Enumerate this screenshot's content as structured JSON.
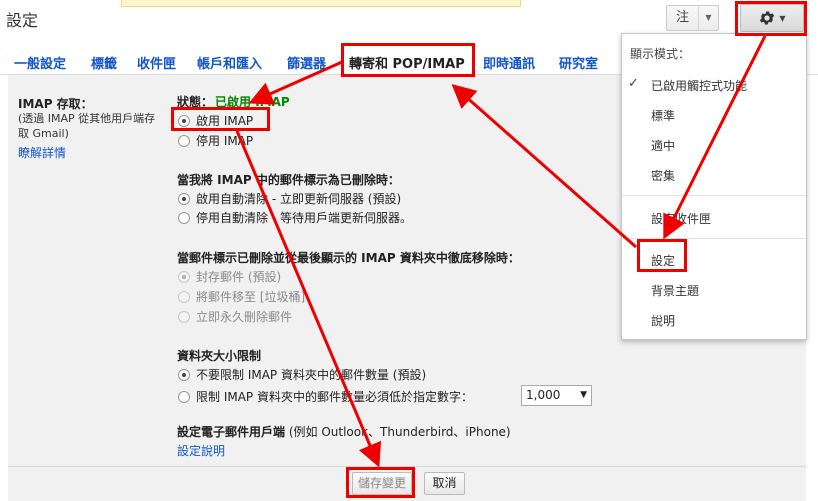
{
  "page": {
    "title": "設定"
  },
  "toolbar": {
    "note_label": "注",
    "note_caret": "▼",
    "settings_caret": "▼"
  },
  "tabs": [
    {
      "label": "一般設定"
    },
    {
      "label": "標籤"
    },
    {
      "label": "收件匣"
    },
    {
      "label": "帳戶和匯入"
    },
    {
      "label": "篩選器"
    },
    {
      "label": "轉寄和 POP/IMAP"
    },
    {
      "label": "即時通訊"
    },
    {
      "label": "研究室"
    }
  ],
  "imap": {
    "title": "IMAP 存取：",
    "subtitle": "(透過 IMAP 從其他用戶端存取 Gmail)",
    "learn_more": "瞭解詳情",
    "status_label": "狀態：",
    "status_value": "已啟用 IMAP",
    "access_options": [
      {
        "label": "啟用 IMAP",
        "selected": true
      },
      {
        "label": "停用 IMAP",
        "selected": false
      }
    ],
    "deleted_heading": "當我將 IMAP 中的郵件標示為已刪除時：",
    "deleted_options": [
      {
        "label": "啟用自動清除 - 立即更新伺服器 (預設)",
        "selected": true
      },
      {
        "label": "停用自動清除 - 等待用戶端更新伺服器。",
        "selected": false
      }
    ],
    "expunged_heading": "當郵件標示已刪除並從最後顯示的 IMAP 資料夾中徹底移除時：",
    "expunged_options": [
      {
        "label": "封存郵件 (預設)",
        "selected": true
      },
      {
        "label": "將郵件移至 [垃圾桶]",
        "selected": false
      },
      {
        "label": "立即永久刪除郵件",
        "selected": false
      }
    ],
    "folder_heading": "資料夾大小限制",
    "folder_options": [
      {
        "label": "不要限制 IMAP 資料夾中的郵件數量 (預設)",
        "selected": true
      },
      {
        "label": "限制 IMAP 資料夾中的郵件數量必須低於指定數字：",
        "selected": false
      }
    ],
    "folder_limit_value": "1,000",
    "client_heading": "設定電子郵件用戶端",
    "client_heading_extra": " (例如 Outlook、Thunderbird、iPhone)",
    "client_link": "設定說明"
  },
  "footer": {
    "save_label": "儲存變更",
    "cancel_label": "取消"
  },
  "settings_menu": {
    "heading": "顯示模式：",
    "check_mark": "✓",
    "items": [
      {
        "label": "已啟用觸控式功能"
      },
      {
        "label": "標準"
      },
      {
        "label": "適中"
      },
      {
        "label": "密集"
      },
      {
        "label": "設定收件匣"
      },
      {
        "label": "設定"
      },
      {
        "label": "背景主題"
      },
      {
        "label": "說明"
      }
    ]
  },
  "colors": {
    "link": "#1155cc",
    "enabled_status": "#008800",
    "annotation": "#ee0000",
    "panel_bg": "#f1f1f1"
  }
}
